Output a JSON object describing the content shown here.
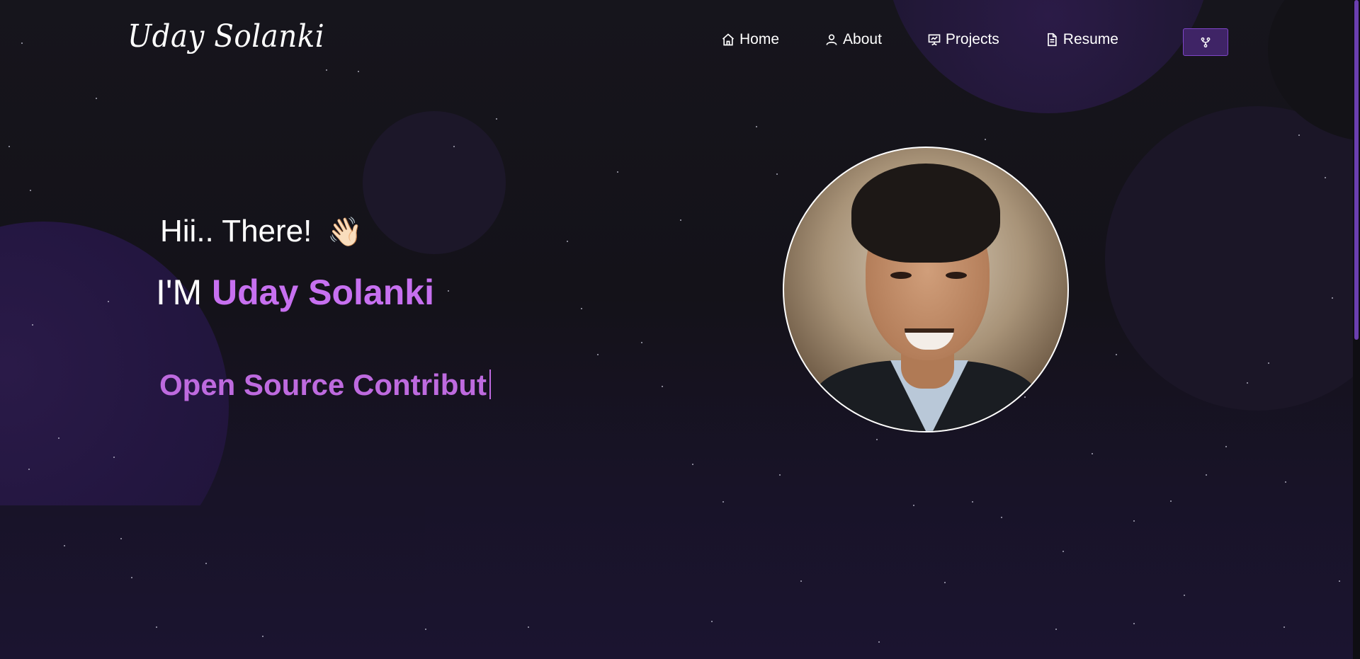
{
  "brand": {
    "logo_text": "Uday Solanki"
  },
  "nav": {
    "items": [
      {
        "label": "Home",
        "icon": "home-icon"
      },
      {
        "label": "About",
        "icon": "user-icon"
      },
      {
        "label": "Projects",
        "icon": "presentation-icon"
      },
      {
        "label": "Resume",
        "icon": "document-icon"
      }
    ],
    "fork_button_icon": "fork-icon"
  },
  "hero": {
    "greeting": "Hii.. There!",
    "wave_emoji": "👋🏻",
    "intro_prefix": "I'M",
    "name": "Uday Solanki",
    "typewriter_text": "Open Source Contribut"
  },
  "colors": {
    "accent": "#c770f0",
    "typewriter": "#be6adf",
    "fork_button_bg": "#3f2466",
    "background": "#141319"
  }
}
